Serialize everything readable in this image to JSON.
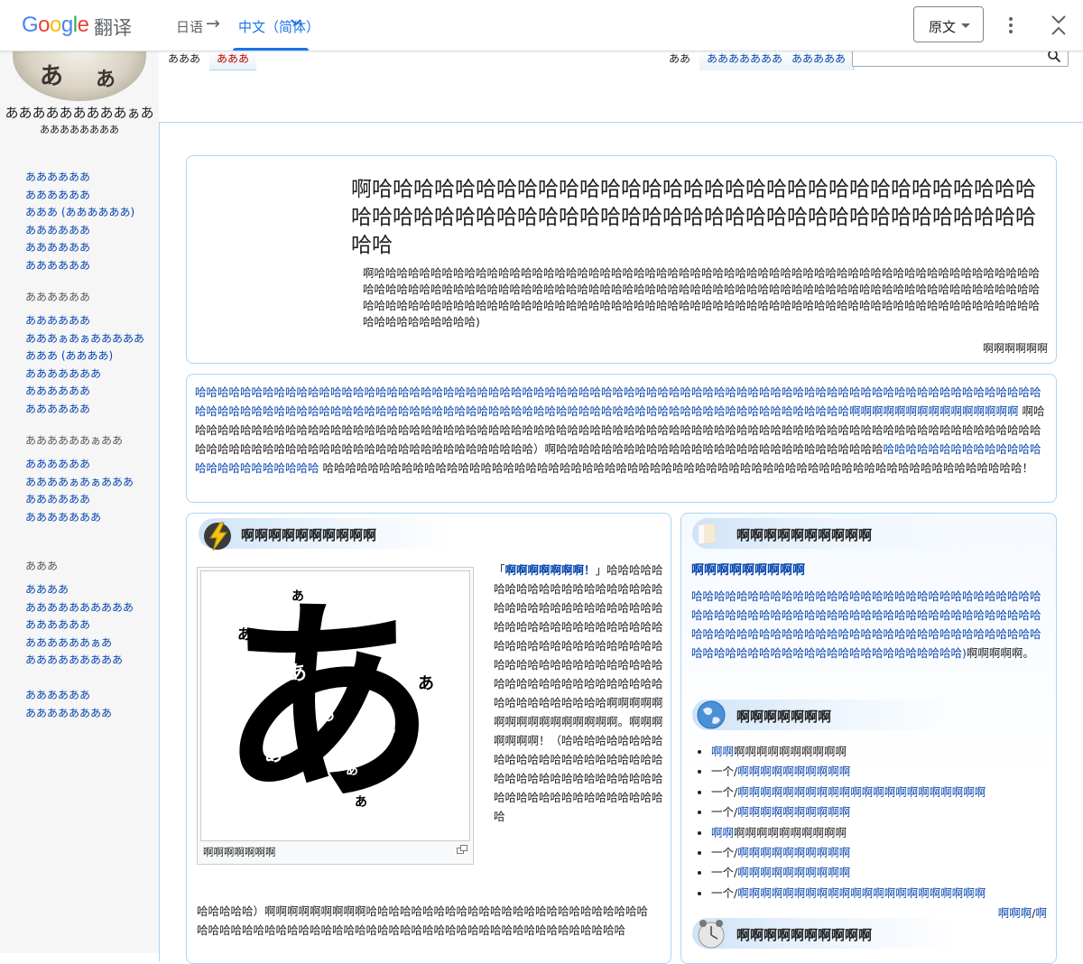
{
  "translate_bar": {
    "logo": "Google",
    "product": "翻译",
    "source_lang": "日语",
    "arrow": "→",
    "target_lang": "中文（简体）",
    "select_label": "原文",
    "accent_color": "#1a73e8"
  },
  "wiki": {
    "logo_title": "あああああああああぁあ",
    "logo_subtitle": "ああああああああ",
    "tabs": {
      "article": "あああ",
      "talk": "あああ",
      "read": "ああ",
      "edit": "あああああああ",
      "history": "あああああ"
    },
    "nav_groups": [
      {
        "heading": "",
        "items": [
          "ああああああ",
          "ああああああ",
          "あああ (ああああああ)",
          "ああああああ",
          "ああああああ",
          "ああああああ"
        ]
      },
      {
        "heading": "ああああああ",
        "items": [
          "ああああああ",
          "あああぁあぁあああああ",
          "あああ (ああああ)",
          "あああああああ",
          "ああああああ",
          "ああああああ"
        ]
      },
      {
        "heading": "ああああああぁああ",
        "items": [
          "ああああああ",
          "ああああぁあぁあああ",
          "ああああああ",
          "あああああああ"
        ]
      },
      {
        "heading": "あああ",
        "items": [
          "ああああ",
          "ああああああああああ",
          "ああああああ",
          "ああああああぁあ",
          "あああああああああ"
        ]
      },
      {
        "heading": "",
        "items": [
          "ああああああ",
          "ああああああああ"
        ]
      }
    ]
  },
  "welcome": {
    "title": "啊哈哈哈哈哈哈哈哈哈哈哈哈哈哈哈哈哈哈哈哈哈哈哈哈哈哈哈哈哈哈哈哈哈哈哈哈哈哈哈哈哈哈哈哈哈哈哈哈哈哈哈哈哈哈哈哈哈哈哈哈哈哈哈哈哈哈哈",
    "description": "啊哈哈哈哈哈哈哈哈哈哈哈哈哈哈哈哈哈哈哈哈哈哈哈哈哈哈哈哈哈哈哈哈哈哈哈哈哈哈哈哈哈哈哈哈哈哈哈哈哈哈哈哈哈哈哈哈哈哈哈哈哈哈哈哈哈哈哈哈哈哈哈哈哈哈哈哈哈哈哈哈哈哈哈哈哈哈哈哈哈哈哈哈哈哈哈哈哈哈哈哈哈哈哈哈哈哈哈哈哈哈哈哈哈哈哈哈哈哈哈哈哈哈哈哈哈哈哈哈哈哈哈哈哈哈哈哈哈哈哈哈哈哈哈哈哈哈哈哈哈哈哈哈哈哈哈哈哈哈哈哈哈哈哈哈哈哈哈哈哈哈哈哈哈哈哈哈哈哈哈哈哈哈哈哈哈哈哈哈哈)",
    "count": "啊啊啊啊啊啊"
  },
  "intro": {
    "link1": "哈哈哈哈哈哈哈哈哈哈哈哈哈哈哈哈哈哈哈哈哈哈哈哈哈哈哈哈哈哈哈哈哈哈哈哈哈哈哈哈哈哈哈哈哈哈哈哈哈哈哈哈哈哈哈哈哈哈哈哈哈哈哈哈哈哈哈哈哈哈哈哈哈哈哈哈哈哈哈哈哈哈哈哈哈哈哈哈哈哈哈哈哈哈哈哈哈哈哈哈哈哈哈哈哈哈哈哈哈哈哈哈哈哈哈哈哈哈哈哈哈哈哈哈哈哈哈哈哈哈哈哈哈啊啊啊啊啊啊啊啊啊啊啊啊啊啊啊",
    "text1": " 啊哈哈哈哈哈哈哈哈哈哈哈哈哈哈哈哈哈哈哈哈哈哈哈哈哈哈哈哈哈哈哈哈哈哈哈哈哈哈哈哈哈哈哈哈哈哈哈哈哈哈哈哈哈哈哈哈哈哈哈哈哈哈哈哈哈哈哈哈哈哈哈哈哈哈哈哈哈哈哈哈哈哈哈哈哈哈哈哈哈哈哈哈哈哈哈哈哈哈哈哈哈哈哈哈哈哈）啊哈哈哈哈哈哈哈哈哈哈哈哈哈哈哈哈哈哈哈哈哈哈哈哈哈哈哈哈哈",
    "link2": "哈哈哈哈哈哈哈哈哈哈哈哈哈哈哈哈哈哈哈哈哈哈哈哈哈",
    "text2": " 哈哈哈哈哈哈哈哈哈哈哈哈哈哈哈哈哈哈哈哈哈哈哈哈哈哈哈哈哈哈哈哈哈哈哈哈哈哈哈哈哈哈哈哈哈哈哈哈哈哈哈哈哈哈哈哈哈哈哈哈哈哈！"
  },
  "featured": {
    "title": "啊啊啊啊啊啊啊啊啊啊",
    "quote_open": "「",
    "quote_link": "啊啊啊啊啊啊啊！",
    "quote_close": "」",
    "text_side": "哈哈哈哈哈哈哈哈哈哈哈哈哈哈哈哈哈哈哈哈哈哈哈哈哈哈哈哈哈哈哈哈哈哈哈哈哈哈哈哈哈哈哈哈哈哈哈哈哈哈哈哈哈哈哈哈哈哈哈哈哈哈哈哈哈哈哈哈哈哈哈哈哈哈哈哈哈哈哈哈哈哈哈哈哈哈哈哈哈哈哈哈哈哈哈哈哈哈哈哈哈哈哈哈哈啊啊啊啊啊啊啊啊啊啊啊啊啊啊啊啊。啊啊啊啊啊啊啊！（哈哈哈哈哈哈哈哈哈哈哈哈哈哈哈哈哈哈哈哈哈哈哈哈哈哈哈哈哈哈哈哈哈哈哈哈哈哈哈哈哈哈哈哈哈哈哈哈哈哈哈哈哈哈哈",
    "text_bottom": "哈哈哈哈哈）啊啊啊啊啊啊啊啊啊哈哈哈哈哈哈哈哈哈哈哈哈哈哈哈哈哈哈哈哈哈哈哈哈哈哈哈哈哈哈哈哈哈哈哈哈哈哈哈哈哈哈哈哈哈哈哈哈哈哈哈哈哈哈哈哈哈哈哈哈哈哈哈",
    "image_caption": "啊啊啊啊啊啊啊",
    "image_glyph": "あ",
    "icon": "lightning-icon"
  },
  "news": {
    "title": "啊啊啊啊啊啊啊啊啊啊",
    "link_title": "啊啊啊啊啊啊啊啊啊",
    "body_link": "哈哈哈哈哈哈哈哈哈哈哈哈哈哈哈哈哈哈哈哈哈哈哈哈哈哈哈哈哈哈哈哈哈哈哈哈哈哈哈哈哈哈哈哈哈哈哈哈哈哈哈哈哈哈哈哈哈哈哈哈哈哈哈哈哈哈哈哈哈哈哈哈哈哈哈哈哈哈哈哈哈哈哈哈哈哈哈哈哈哈哈哈哈哈哈哈哈哈哈哈哈哈哈哈哈哈哈哈哈哈哈哈哈哈哈哈哈)",
    "body_text": "啊啊啊啊啊。",
    "world_title": "啊啊啊啊啊啊啊",
    "list": [
      {
        "prefix": "",
        "link": "啊啊",
        "suffix": "啊啊啊啊啊啊啊啊啊啊"
      },
      {
        "prefix": "一个/",
        "link": "啊啊啊啊啊啊啊啊啊啊",
        "suffix": ""
      },
      {
        "prefix": "一个/",
        "link": "啊啊啊啊啊啊啊啊啊啊啊啊啊啊啊啊啊啊啊啊啊啊",
        "suffix": ""
      },
      {
        "prefix": "一个/",
        "link": "啊啊啊啊啊啊啊啊啊啊",
        "suffix": ""
      },
      {
        "prefix": "",
        "link": "啊啊",
        "suffix": "啊啊啊啊啊啊啊啊啊啊"
      },
      {
        "prefix": "一个/",
        "link": "啊啊啊啊啊啊啊啊啊啊",
        "suffix": ""
      },
      {
        "prefix": "一个/",
        "link": "啊啊啊啊啊啊啊啊啊啊",
        "suffix": ""
      },
      {
        "prefix": "一个/",
        "link": "啊啊啊啊啊啊啊啊啊啊啊啊啊啊啊啊啊啊啊啊啊啊",
        "suffix": ""
      }
    ],
    "more_link1": "啊啊啊",
    "more_sep": "/",
    "more_link2": "啊",
    "next_title": "啊啊啊啊啊啊啊啊啊啊"
  }
}
